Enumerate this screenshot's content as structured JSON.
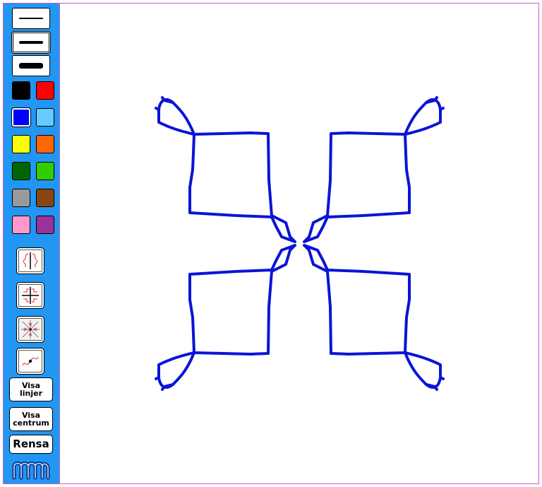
{
  "toolbar": {
    "line_widths": [
      "thin",
      "medium",
      "thick"
    ],
    "selected_width": "medium",
    "colors": [
      "#000000",
      "#ff0000",
      "#0000ff",
      "#66ccff",
      "#ffff00",
      "#ff6600",
      "#006600",
      "#33cc00",
      "#999999",
      "#8b4513",
      "#ff99cc",
      "#993399"
    ],
    "selected_color": "#0000ff",
    "symmetry_modes": [
      "mirror-vertical-icon",
      "mirror-four-icon",
      "kaleidoscope-icon",
      "point-symmetry-icon"
    ],
    "selected_symmetry": "kaleidoscope-icon",
    "show_lines": [
      "Visa",
      "linjer"
    ],
    "show_center": [
      "Visa",
      "centrum"
    ],
    "clear": "Rensa"
  },
  "canvas": {
    "stroke_color": "#0b14d6"
  }
}
